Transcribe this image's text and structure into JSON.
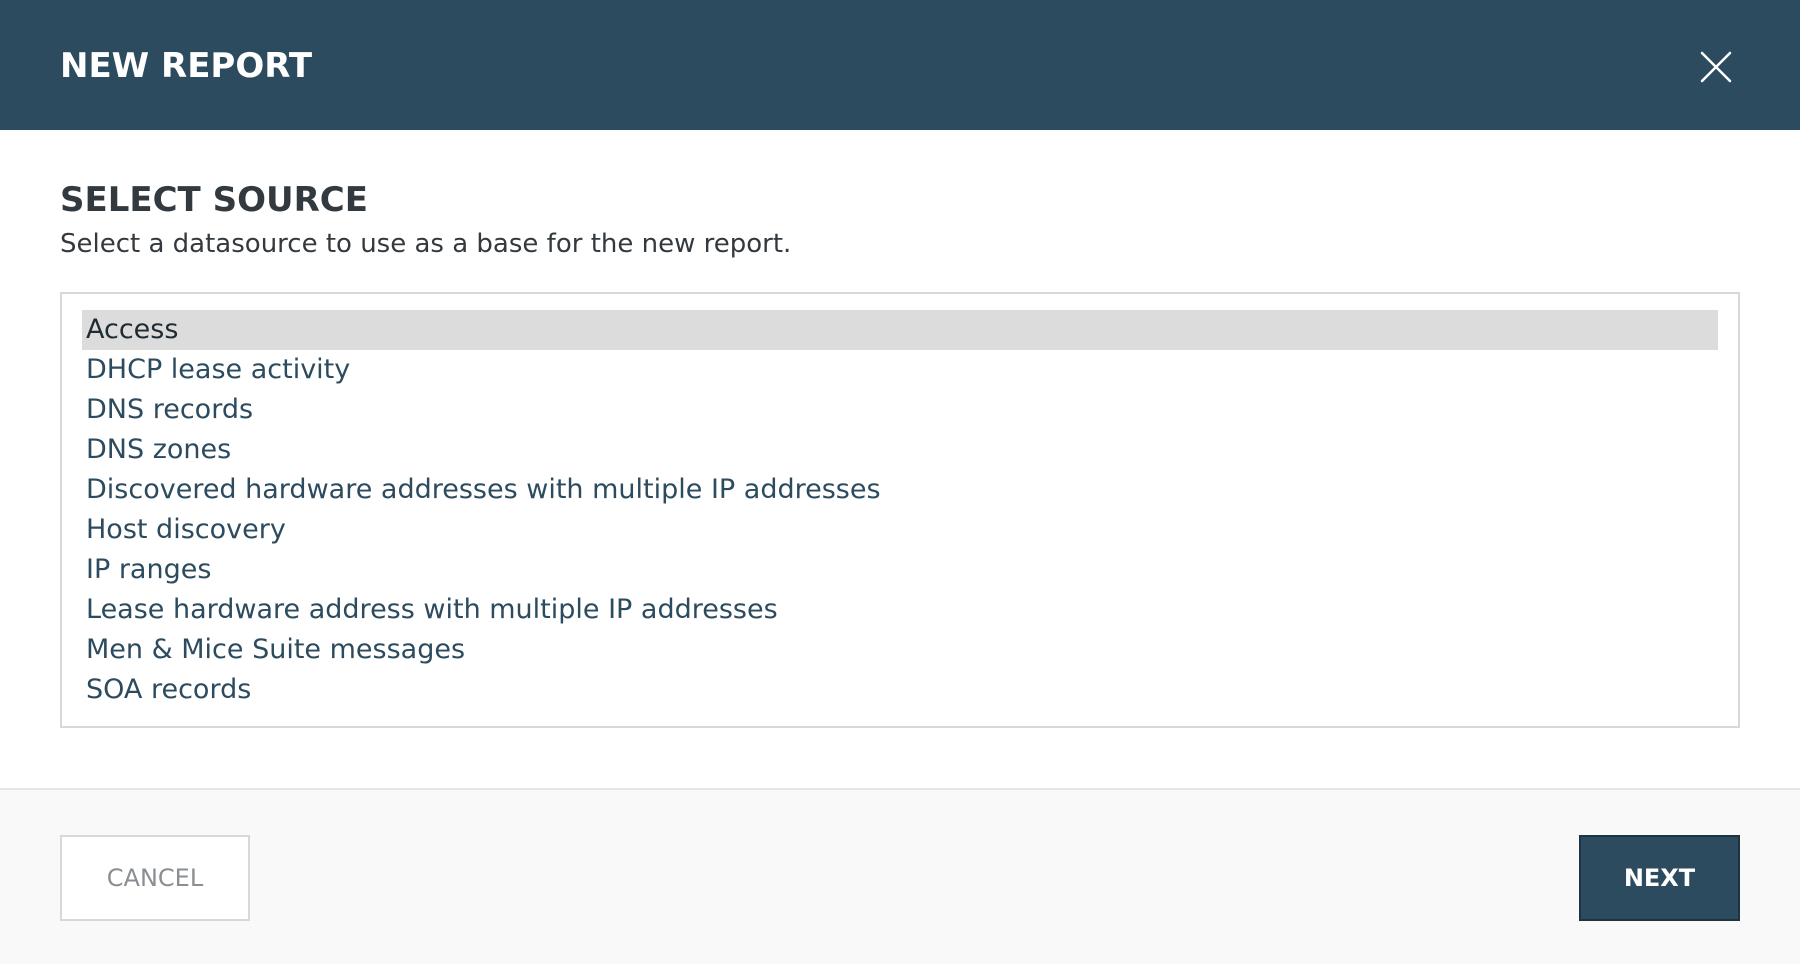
{
  "header": {
    "title": "NEW REPORT",
    "close_icon": "close-icon"
  },
  "colors": {
    "header_bg": "#2d4b5e",
    "selected_row_bg": "#dcdcdc",
    "primary_button_bg": "#2d4b5e",
    "footer_bg": "#f9f9f9"
  },
  "content": {
    "title": "SELECT SOURCE",
    "subtitle": "Select a datasource to use as a base for the new report.",
    "sources": [
      {
        "label": "Access",
        "selected": true
      },
      {
        "label": "DHCP lease activity",
        "selected": false
      },
      {
        "label": "DNS records",
        "selected": false
      },
      {
        "label": "DNS zones",
        "selected": false
      },
      {
        "label": "Discovered hardware addresses with multiple IP addresses",
        "selected": false
      },
      {
        "label": "Host discovery",
        "selected": false
      },
      {
        "label": "IP ranges",
        "selected": false
      },
      {
        "label": "Lease hardware address with multiple IP addresses",
        "selected": false
      },
      {
        "label": "Men & Mice Suite messages",
        "selected": false
      },
      {
        "label": "SOA records",
        "selected": false
      }
    ]
  },
  "footer": {
    "cancel_label": "CANCEL",
    "next_label": "NEXT"
  }
}
